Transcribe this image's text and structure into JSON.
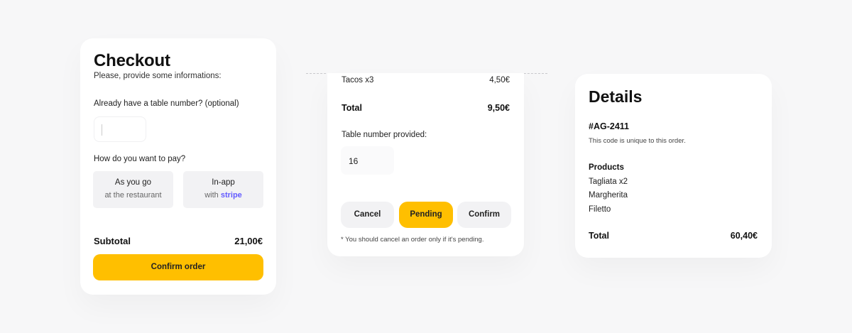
{
  "checkout": {
    "title": "Checkout",
    "subtitle": "Please, provide some informations:",
    "table_label": "Already have a table number? (optional)",
    "table_value": "",
    "pay_label": "How do you want to pay?",
    "pay_options": [
      {
        "title": "As you go",
        "subtitle": "at the restaurant"
      },
      {
        "title": "In-app",
        "subtitle_prefix": "with",
        "brand": "stripe"
      }
    ],
    "subtotal_label": "Subtotal",
    "subtotal_value": "21,00€",
    "confirm_label": "Confirm order"
  },
  "receipt": {
    "item": {
      "name": "Tacos x3",
      "price": "4,50€"
    },
    "total_label": "Total",
    "total_value": "9,50€",
    "table_provided_label": "Table number provided:",
    "table_number": "16",
    "buttons": {
      "cancel": "Cancel",
      "pending": "Pending",
      "confirm": "Confirm"
    },
    "note": "* You should cancel an order only if it's pending."
  },
  "details": {
    "title": "Details",
    "code": "#AG-2411",
    "code_note": "This code is unique to this order.",
    "products_label": "Products",
    "products": [
      "Tagliata x2",
      "Margherita",
      "Filetto"
    ],
    "total_label": "Total",
    "total_value": "60,40€"
  },
  "colors": {
    "accent": "#ffbf00",
    "stripe": "#635bff",
    "neutral_button": "#f2f2f4"
  }
}
